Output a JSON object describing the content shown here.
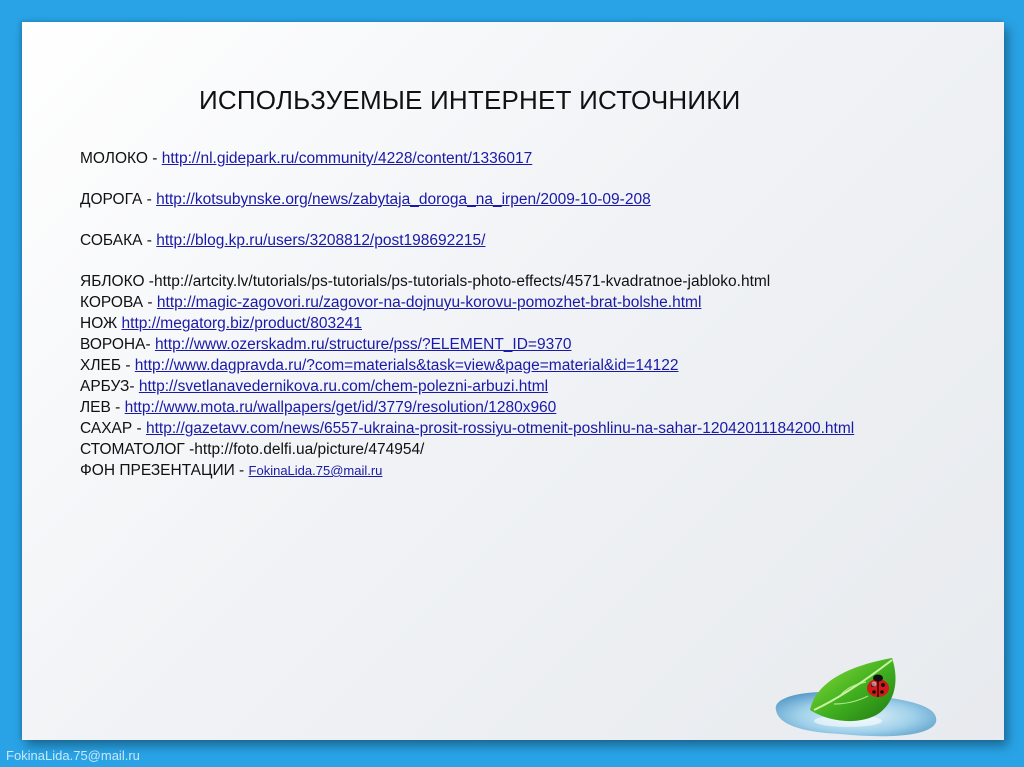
{
  "title": "ИСПОЛЬЗУЕМЫЕ ИНТЕРНЕТ  ИСТОЧНИКИ",
  "sources": [
    {
      "label": "МОЛОКО - ",
      "url": "http://nl.gidepark.ru/community/4228/content/1336017"
    },
    {
      "label": "ДОРОГА - ",
      "url": "http://kotsubynske.org/news/zabytaja_doroga_na_irpen/2009-10-09-208"
    },
    {
      "label": "СОБАКА  -  ",
      "url": "http://blog.kp.ru/users/3208812/post198692215/"
    },
    {
      "label": "ЯБЛОКО -http://artcity.lv/tutorials/ps-tutorials/ps-tutorials-photo-effects/4571-kvadratnoe-jabloko.html"
    },
    {
      "label": "КОРОВА - ",
      "url": "http://magic-zagovori.ru/zagovor-na-dojnuyu-korovu-pomozhet-brat-bolshe.html"
    },
    {
      "label": "НОЖ ",
      "url": "http://megatorg.biz/product/803241"
    },
    {
      "label": "ВОРОНА- ",
      "url": "http://www.ozerskadm.ru/structure/pss/?ELEMENT_ID=9370"
    },
    {
      "label": "ХЛЕБ - ",
      "url": "http://www.dagpravda.ru/?com=materials&task=view&page=material&id=14122"
    },
    {
      "label": "АРБУЗ- ",
      "url": "http://svetlanavedernikova.ru.com/chem-polezni-arbuzi.html"
    },
    {
      "label": "ЛЕВ - ",
      "url": "http://www.mota.ru/wallpapers/get/id/3779/resolution/1280x960"
    },
    {
      "label": "САХАР - ",
      "url": "http://gazetavv.com/news/6557-ukraina-prosit-rossiyu-otmenit-poshlinu-na-sahar-12042011184200.html"
    },
    {
      "label": "СТОМАТОЛОГ -http://foto.delfi.ua/picture/474954/"
    },
    {
      "label": "ФОН ПРЕЗЕНТАЦИИ - ",
      "url": "FokinaLida.75@mail.ru"
    }
  ],
  "footer": "FokinaLida.75@mail.ru",
  "icons": {
    "decoration": "leaf-ladybug-icon"
  },
  "colors": {
    "frame": "#29a3e6",
    "link": "#1a1aa8",
    "text": "#111111"
  }
}
